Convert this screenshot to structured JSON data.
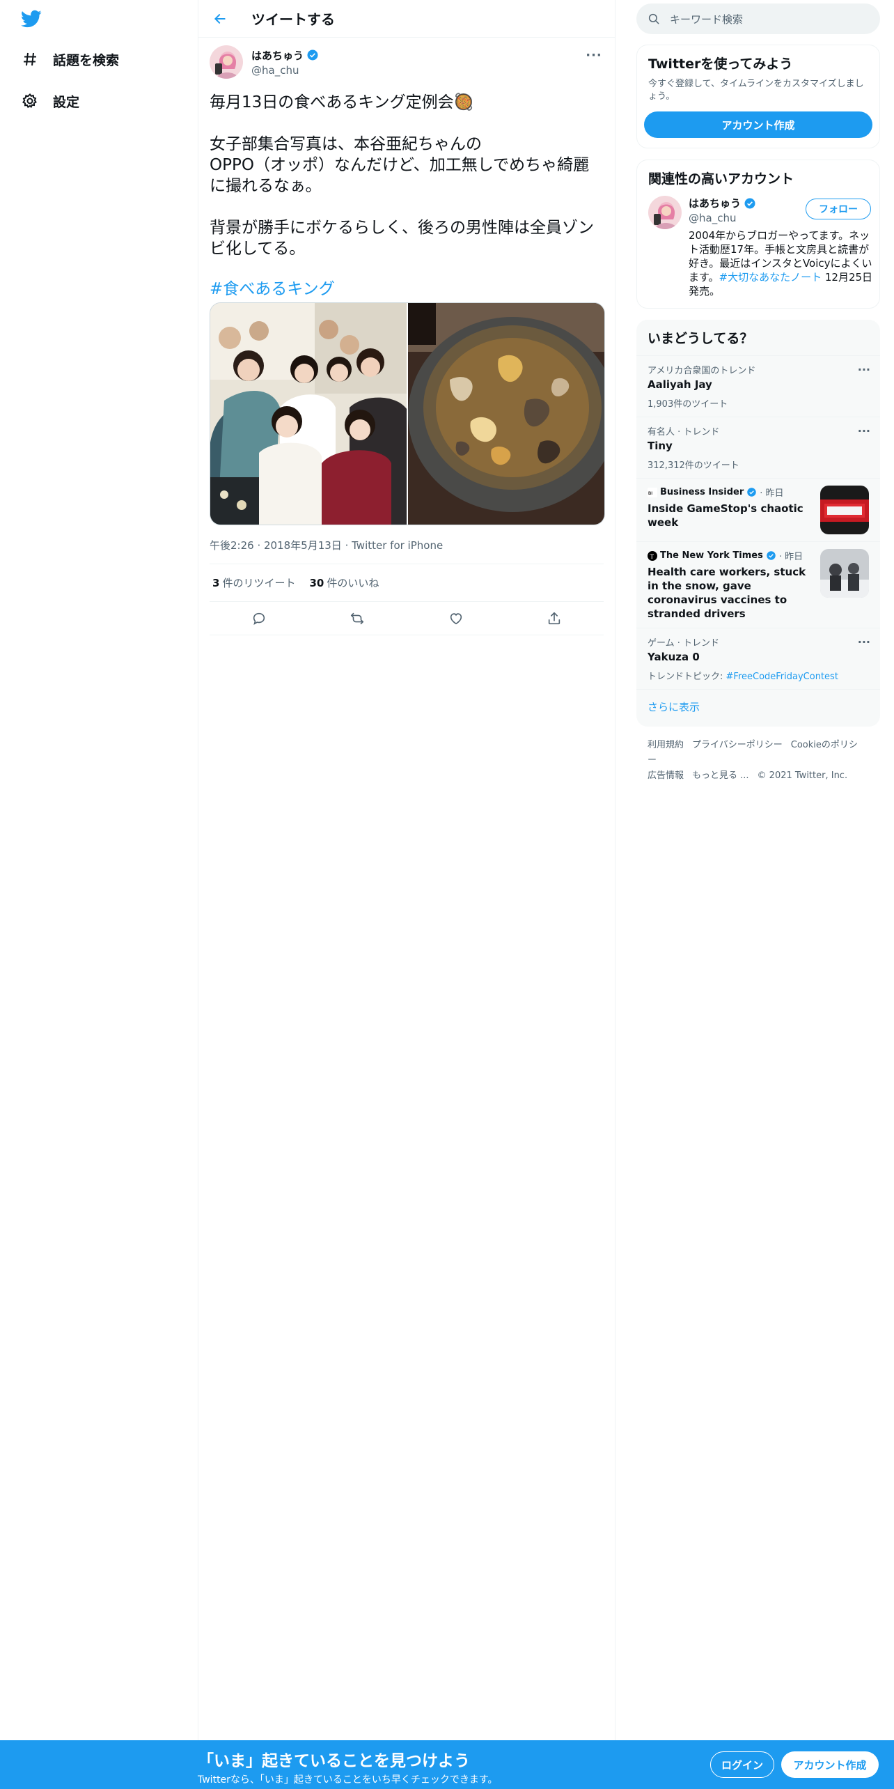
{
  "nav": {
    "logo": "twitter-bird-icon",
    "explore_label": "話題を検索",
    "settings_label": "設定"
  },
  "header": {
    "title": "ツイートする"
  },
  "tweet": {
    "author_name": "はあちゅう",
    "author_handle": "@ha_chu",
    "text": "毎月13日の食べあるキング定例会🥘\n\n女子部集合写真は、本谷亜紀ちゃんの\nOPPO（オッポ）なんだけど、加工無しでめちゃ綺麗\nに撮れるなぁ。\n\n背景が勝手にボケるらしく、後ろの男性陣は全員ゾン\nビ化してる。",
    "hashtag": "#食べあるキング",
    "time": "午後2:26",
    "date": "2018年5月13日",
    "source": "Twitter for iPhone",
    "retweets_count": "3",
    "retweets_label": "件のリツイート",
    "likes_count": "30",
    "likes_label": "件のいいね"
  },
  "search": {
    "placeholder": "キーワード検索"
  },
  "signup": {
    "title": "Twitterを使ってみよう",
    "subtitle": "今すぐ登録して、タイムラインをカスタマイズしましょう。",
    "button": "アカウント作成"
  },
  "related": {
    "title": "関連性の高いアカウント",
    "name": "はあちゅう",
    "handle": "@ha_chu",
    "follow": "フォロー",
    "bio_part1": "2004年からブロガーやってます。ネット活動歴17年。手帳と文房具と読書が好き。最近はインスタとVoicyによくいます。",
    "bio_link": "#大切なあなたノート",
    "bio_part2": " 12月25日発売。"
  },
  "trends": {
    "title": "いまどうしてる？",
    "items": [
      {
        "context": "アメリカ合衆国のトレンド",
        "name": "Aaliyah Jay",
        "count": "1,903件のツイート"
      },
      {
        "context": "有名人 · トレンド",
        "name": "Tiny",
        "count": "312,312件のツイート"
      }
    ],
    "news": [
      {
        "source": "Business Insider",
        "time": "· 昨日",
        "headline": "Inside GameStop's chaotic week"
      },
      {
        "source": "The New York Times",
        "time": "· 昨日",
        "headline": "Health care workers, stuck in the snow, gave coronavirus vaccines to stranded drivers"
      }
    ],
    "game": {
      "context": "ゲーム · トレンド",
      "name": "Yakuza 0",
      "topic_label": "トレンドトピック: ",
      "topic_link": "#FreeCodeFridayContest"
    },
    "show_more": "さらに表示"
  },
  "footer": {
    "terms": "利用規約",
    "privacy": "プライバシーポリシー",
    "cookie": "Cookieのポリシー",
    "ads": "広告情報",
    "more": "もっと見る ...",
    "copyright": "© 2021 Twitter, Inc."
  },
  "bottom": {
    "headline": "「いま」起きていることを見つけよう",
    "sub": "Twitterなら、「いま」起きていることをいち早くチェックできます。",
    "login": "ログイン",
    "signup": "アカウント作成"
  },
  "colors": {
    "brand": "#1d9bf0",
    "text": "#0f1419",
    "muted": "#536471"
  }
}
